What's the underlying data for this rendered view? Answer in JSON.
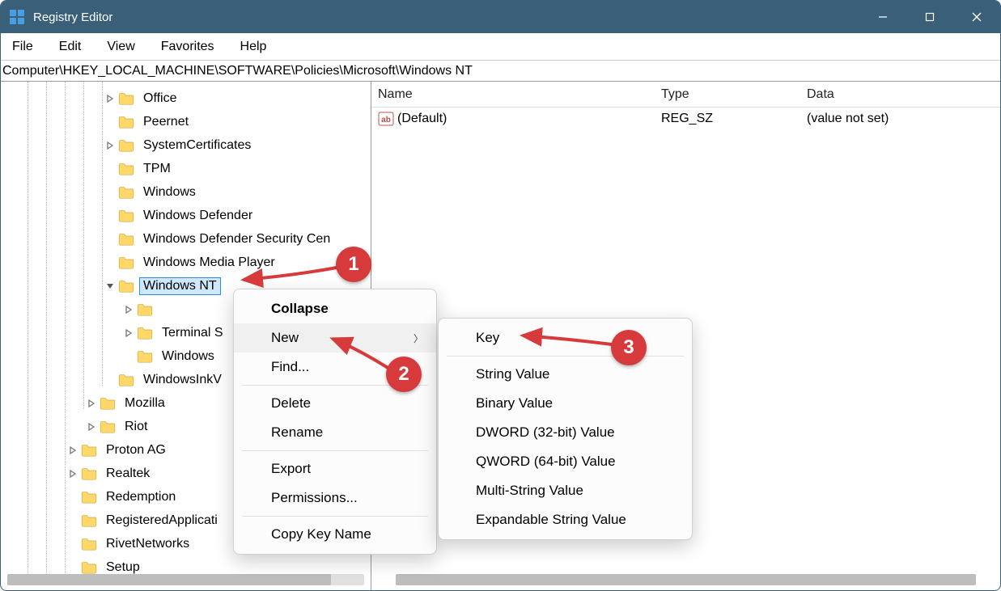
{
  "window": {
    "title": "Registry Editor"
  },
  "menu": {
    "file": "File",
    "edit": "Edit",
    "view": "View",
    "favorites": "Favorites",
    "help": "Help"
  },
  "address": {
    "path": "Computer\\HKEY_LOCAL_MACHINE\\SOFTWARE\\Policies\\Microsoft\\Windows NT"
  },
  "tree": {
    "items": [
      {
        "indent": 127,
        "exp": ">",
        "label": "Office"
      },
      {
        "indent": 127,
        "exp": "",
        "label": "Peernet"
      },
      {
        "indent": 127,
        "exp": ">",
        "label": "SystemCertificates"
      },
      {
        "indent": 127,
        "exp": "",
        "label": "TPM"
      },
      {
        "indent": 127,
        "exp": "",
        "label": "Windows"
      },
      {
        "indent": 127,
        "exp": "",
        "label": "Windows Defender"
      },
      {
        "indent": 127,
        "exp": "",
        "label": "Windows Defender Security Cen"
      },
      {
        "indent": 127,
        "exp": "",
        "label": "Windows Media Player"
      },
      {
        "indent": 127,
        "exp": "v",
        "label": "Windows NT",
        "selected": true
      },
      {
        "indent": 150,
        "exp": ">",
        "label": ""
      },
      {
        "indent": 150,
        "exp": ">",
        "label": "Terminal S"
      },
      {
        "indent": 150,
        "exp": "",
        "label": "Windows "
      },
      {
        "indent": 127,
        "exp": "",
        "label": "WindowsInkV"
      },
      {
        "indent": 104,
        "exp": ">",
        "label": "Mozilla"
      },
      {
        "indent": 104,
        "exp": ">",
        "label": "Riot"
      },
      {
        "indent": 81,
        "exp": ">",
        "label": "Proton AG"
      },
      {
        "indent": 81,
        "exp": ">",
        "label": "Realtek"
      },
      {
        "indent": 81,
        "exp": "",
        "label": "Redemption"
      },
      {
        "indent": 81,
        "exp": "",
        "label": "RegisteredApplicati"
      },
      {
        "indent": 81,
        "exp": "",
        "label": "RivetNetworks"
      },
      {
        "indent": 81,
        "exp": "",
        "label": "Setup"
      }
    ]
  },
  "values": {
    "header": {
      "name": "Name",
      "type": "Type",
      "data": "Data"
    },
    "rows": [
      {
        "name": "(Default)",
        "type": "REG_SZ",
        "data": "(value not set)"
      }
    ]
  },
  "ctx1": {
    "collapse": "Collapse",
    "new": "New",
    "find": "Find...",
    "delete": "Delete",
    "rename": "Rename",
    "export": "Export",
    "permissions": "Permissions...",
    "copykey": "Copy Key Name"
  },
  "ctx2": {
    "key": "Key",
    "string": "String Value",
    "binary": "Binary Value",
    "dword": "DWORD (32-bit) Value",
    "qword": "QWORD (64-bit) Value",
    "multi": "Multi-String Value",
    "expand": "Expandable String Value"
  },
  "anno": {
    "a1": "1",
    "a2": "2",
    "a3": "3"
  }
}
